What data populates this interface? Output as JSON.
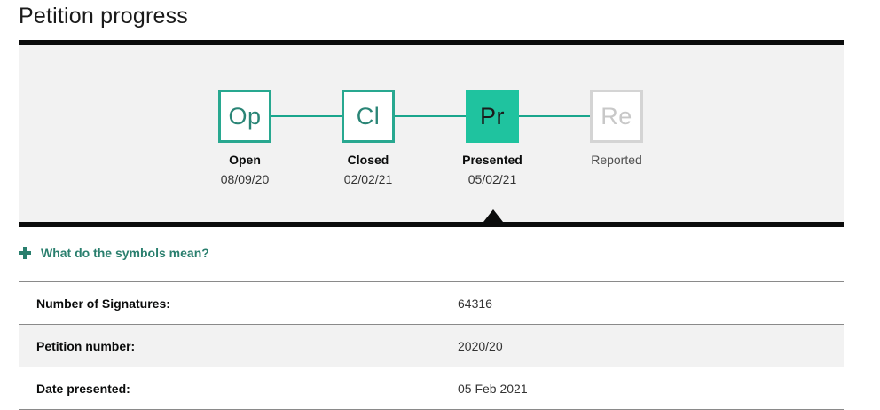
{
  "page": {
    "title": "Petition progress"
  },
  "progress": {
    "steps": [
      {
        "abbr": "Op",
        "label": "Open",
        "date": "08/09/20",
        "state": "done"
      },
      {
        "abbr": "Cl",
        "label": "Closed",
        "date": "02/02/21",
        "state": "done"
      },
      {
        "abbr": "Pr",
        "label": "Presented",
        "date": "05/02/21",
        "state": "current"
      },
      {
        "abbr": "Re",
        "label": "Reported",
        "date": "",
        "state": "future"
      }
    ],
    "colors": {
      "done_border": "#28a890",
      "current_fill": "#1fc39f",
      "future_border": "#d4d4d4",
      "bar": "#0b0c0c"
    }
  },
  "symbols_toggle": {
    "label": "What do the symbols mean?",
    "icon": "plus-icon"
  },
  "details": [
    {
      "label": "Number of Signatures:",
      "value": "64316"
    },
    {
      "label": "Petition number:",
      "value": "2020/20"
    },
    {
      "label": "Date presented:",
      "value": "05 Feb 2021"
    }
  ]
}
